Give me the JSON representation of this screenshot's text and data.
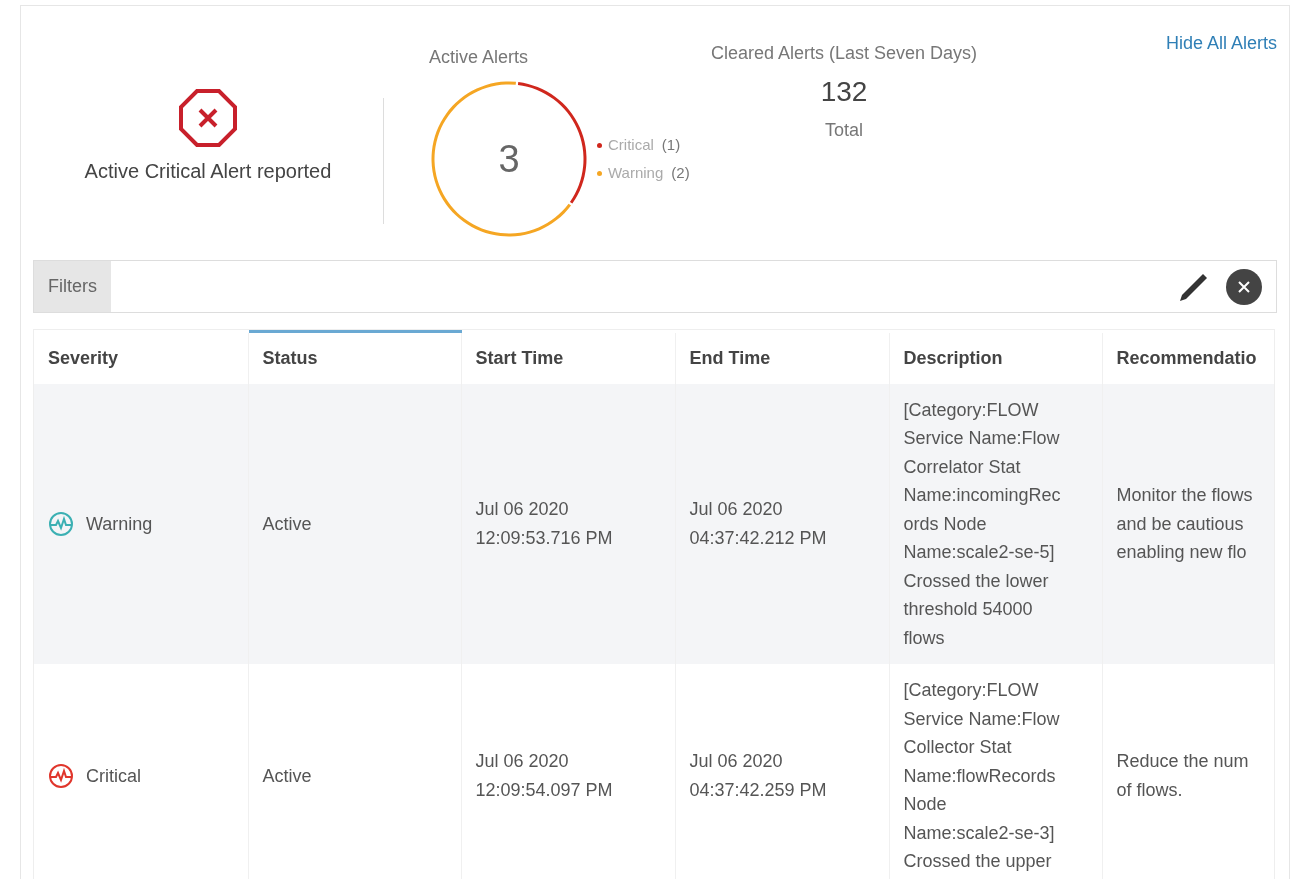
{
  "alert_banner": {
    "kind": "critical",
    "message": "Active Critical Alert reported"
  },
  "active_alerts": {
    "total": "3",
    "chart_data": {
      "type": "donut",
      "title": "Active Alerts",
      "categories": [
        "Critical",
        "Warning"
      ],
      "values": [
        33.33,
        66.67
      ],
      "colors": [
        "#d0271d",
        "#f5a623"
      ]
    },
    "legend_counts": [
      "(1)",
      "(2)"
    ]
  },
  "cleared_alerts": {
    "title": "Cleared Alerts (Last Seven Days)",
    "value": "132",
    "caption": "Total"
  },
  "hide_link": "Hide All Alerts",
  "filters": {
    "label": "Filters"
  },
  "table": {
    "columns": [
      {
        "label": "Severity",
        "sorted": false
      },
      {
        "label": "Status",
        "sorted": true
      },
      {
        "label": "Start Time",
        "sorted": false
      },
      {
        "label": "End Time",
        "sorted": false
      },
      {
        "label": "Description",
        "sorted": false
      },
      {
        "label": "Recommendatio",
        "sorted": false
      }
    ],
    "rows": [
      {
        "severity": {
          "kind": "warning",
          "label": "Warning"
        },
        "status": "Active",
        "start": [
          "Jul 06 2020",
          "12:09:53.716 PM"
        ],
        "end": [
          "Jul 06 2020",
          "04:37:42.212 PM"
        ],
        "description": [
          "[Category:FLOW",
          "Service Name:Flow",
          "Correlator Stat",
          "Name:incomingRec",
          "ords Node",
          "Name:scale2-se-5]",
          "Crossed the lower",
          "threshold 54000",
          "flows"
        ],
        "recommendation": [
          "Monitor the flows",
          "and be cautious",
          "enabling new flo"
        ]
      },
      {
        "severity": {
          "kind": "critical",
          "label": "Critical"
        },
        "status": "Active",
        "start": [
          "Jul 06 2020",
          "12:09:54.097 PM"
        ],
        "end": [
          "Jul 06 2020",
          "04:37:42.259 PM"
        ],
        "description": [
          "[Category:FLOW",
          "Service Name:Flow",
          "Collector Stat",
          "Name:flowRecords",
          "Node",
          "Name:scale2-se-3]",
          "Crossed the upper"
        ],
        "recommendation": [
          "Reduce the num",
          "of flows."
        ]
      }
    ]
  }
}
